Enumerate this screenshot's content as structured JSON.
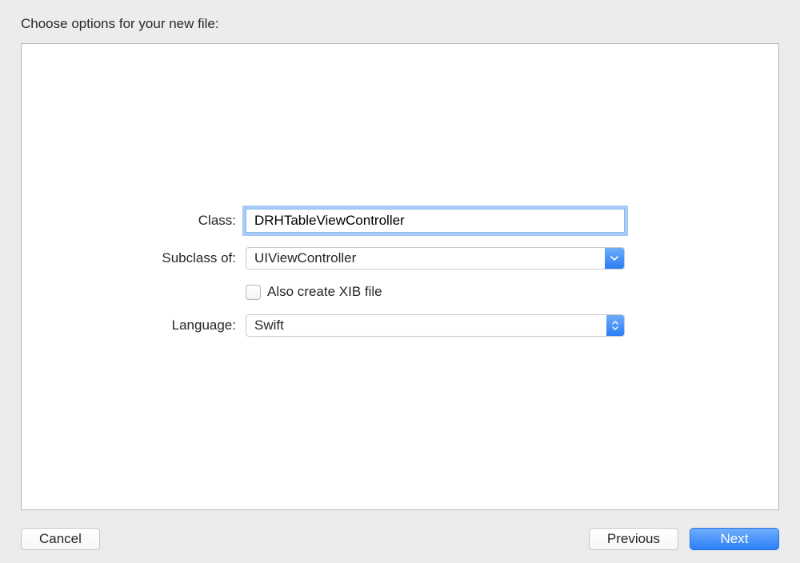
{
  "dialog": {
    "title": "Choose options for your new file:"
  },
  "form": {
    "class_label": "Class:",
    "class_value": "DRHTableViewController",
    "subclass_label": "Subclass of:",
    "subclass_value": "UIViewController",
    "xib_label": "Also create XIB file",
    "xib_checked": false,
    "language_label": "Language:",
    "language_value": "Swift"
  },
  "buttons": {
    "cancel": "Cancel",
    "previous": "Previous",
    "next": "Next"
  }
}
